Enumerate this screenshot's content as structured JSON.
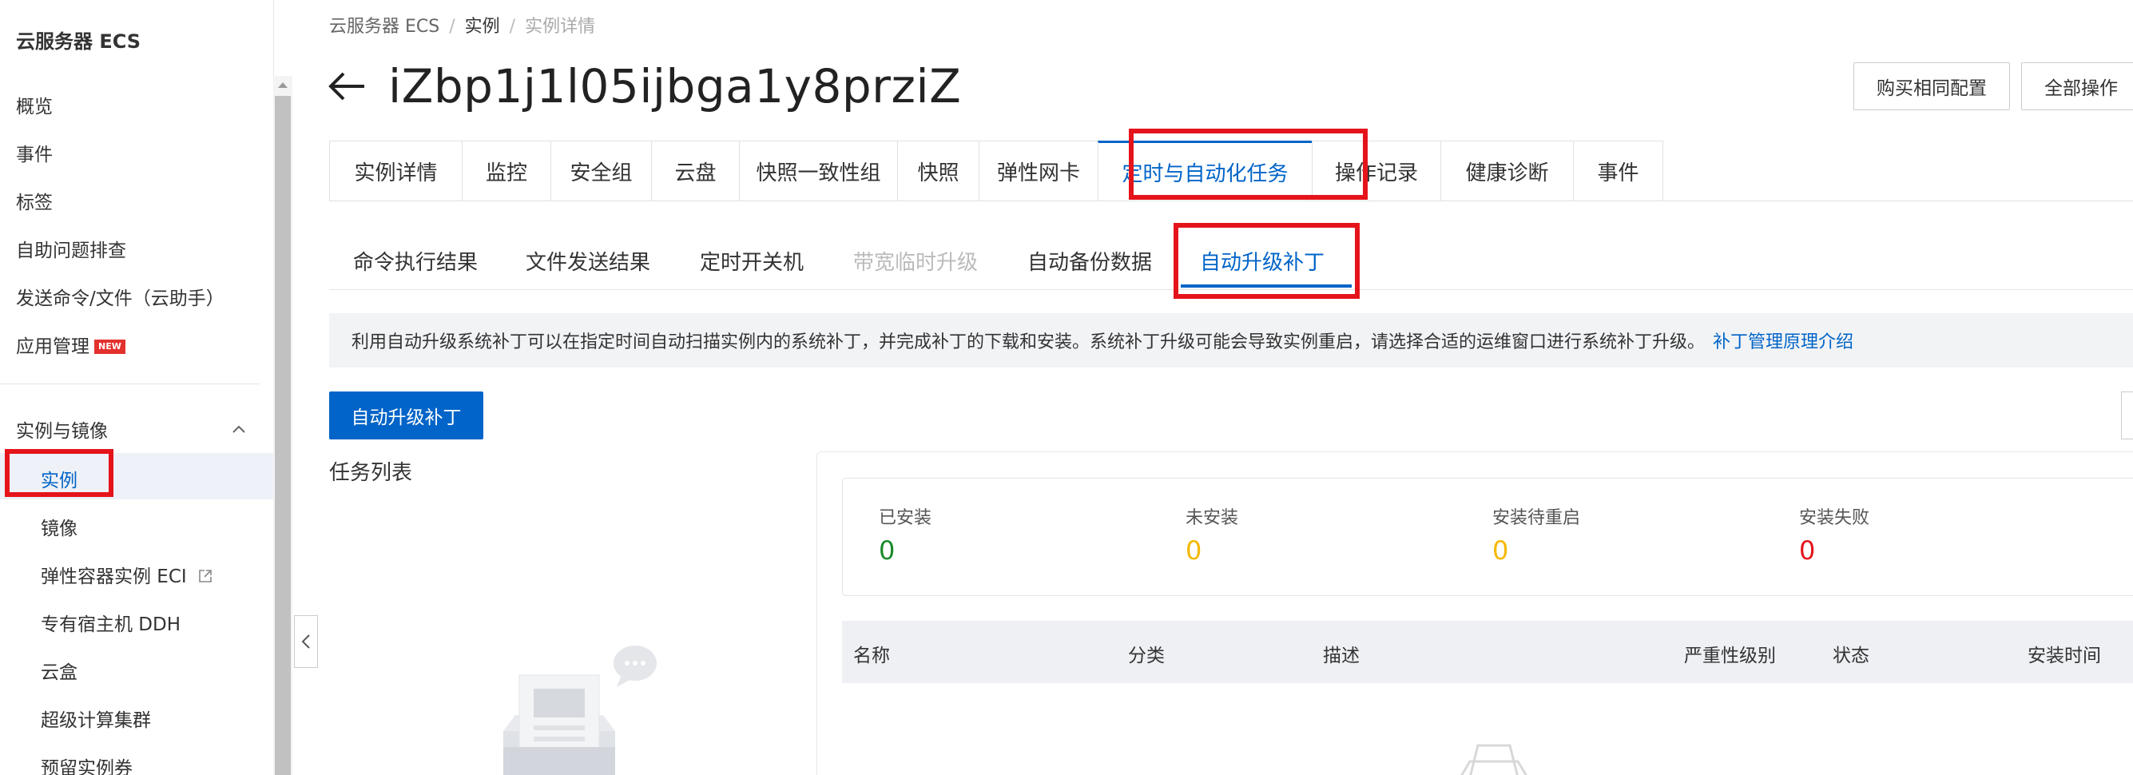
{
  "sidebar": {
    "title": "云服务器 ECS",
    "items": [
      {
        "label": "概览"
      },
      {
        "label": "事件"
      },
      {
        "label": "标签"
      },
      {
        "label": "自助问题排查"
      },
      {
        "label": "发送命令/文件（云助手）"
      },
      {
        "label": "应用管理",
        "badge": "NEW"
      }
    ],
    "group": {
      "label": "实例与镜像",
      "items": [
        {
          "label": "实例"
        },
        {
          "label": "镜像"
        },
        {
          "label": "弹性容器实例 ECI"
        },
        {
          "label": "专有宿主机 DDH"
        },
        {
          "label": "云盒"
        },
        {
          "label": "超级计算集群"
        },
        {
          "label": "预留实例券"
        }
      ]
    }
  },
  "breadcrumb": [
    "云服务器 ECS",
    "实例",
    "实例详情"
  ],
  "header": {
    "title": "iZbp1j1l05ijbga1y8prziZ",
    "buy_same_label": "购买相同配置",
    "all_ops_label": "全部操作"
  },
  "tabs": [
    "实例详情",
    "监控",
    "安全组",
    "云盘",
    "快照一致性组",
    "快照",
    "弹性网卡",
    "定时与自动化任务",
    "操作记录",
    "健康诊断",
    "事件"
  ],
  "subtabs": [
    "命令执行结果",
    "文件发送结果",
    "定时开关机",
    "带宽临时升级",
    "自动备份数据",
    "自动升级补丁"
  ],
  "info": {
    "text": "利用自动升级系统补丁可以在指定时间自动扫描实例内的系统补丁，并完成补丁的下载和安装。系统补丁升级可能会导致实例重启，请选择合适的运维窗口进行系统补丁升级。",
    "link": "补丁管理原理介绍"
  },
  "primary_button": "自动升级补丁",
  "task_list_label": "任务列表",
  "stats": [
    {
      "label": "已安装",
      "value": "0",
      "color": "#1a8a2a"
    },
    {
      "label": "未安装",
      "value": "0",
      "color": "#f5b800"
    },
    {
      "label": "安装待重启",
      "value": "0",
      "color": "#f5b800"
    },
    {
      "label": "安装失败",
      "value": "0",
      "color": "#e3141c"
    }
  ],
  "table": {
    "headers": [
      "名称",
      "分类",
      "描述",
      "严重性级别",
      "状态",
      "安装时间"
    ]
  },
  "colors": {
    "accent": "#0064c8",
    "annotation_red": "#e5141b"
  }
}
